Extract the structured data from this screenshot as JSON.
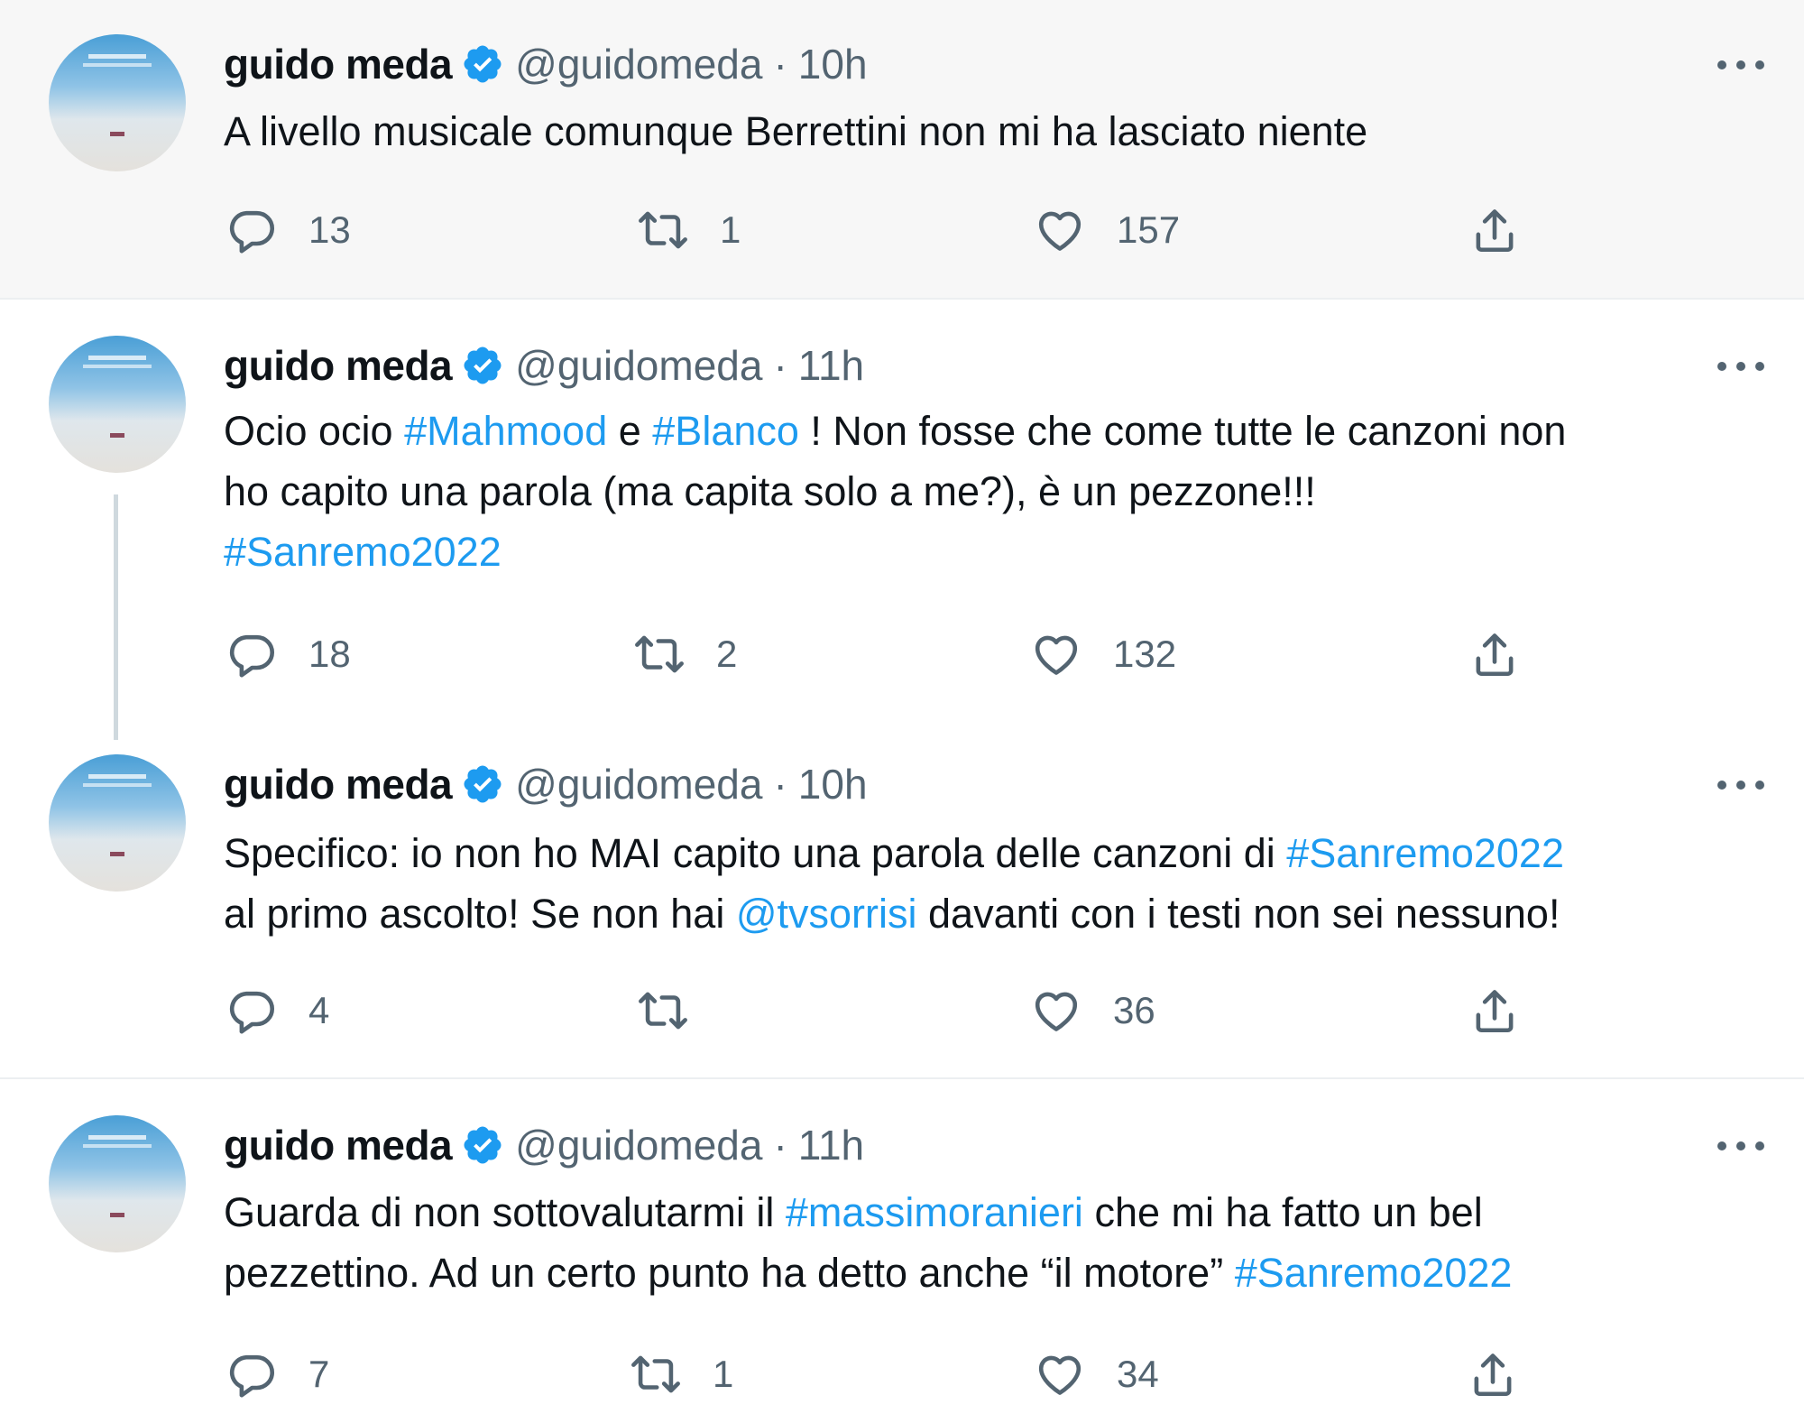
{
  "colors": {
    "link": "#1d9bf0",
    "muted": "#536471",
    "verified": "#1d9bf0"
  },
  "tweets": [
    {
      "name": "guido meda",
      "handle": "@guidomeda",
      "separator": "·",
      "time": "10h",
      "segments": [
        {
          "t": "A livello musicale comunque Berrettini non mi ha lasciato niente"
        }
      ],
      "replies": "13",
      "retweets": "1",
      "likes": "157"
    },
    {
      "name": "guido meda",
      "handle": "@guidomeda",
      "separator": "·",
      "time": "11h",
      "segments": [
        {
          "t": "Ocio ocio "
        },
        {
          "t": "#Mahmood",
          "link": true
        },
        {
          "t": " e "
        },
        {
          "t": "#Blanco",
          "link": true
        },
        {
          "t": " ! Non fosse che come tutte le canzoni non",
          "br": true
        },
        {
          "t": "ho capito una parola (ma capita solo a me?), è un pezzone!!!",
          "br": true
        },
        {
          "t": "#Sanremo2022",
          "link": true
        }
      ],
      "replies": "18",
      "retweets": "2",
      "likes": "132"
    },
    {
      "name": "guido meda",
      "handle": "@guidomeda",
      "separator": "·",
      "time": "10h",
      "segments": [
        {
          "t": "Specifico: io non ho MAI capito una parola delle canzoni di "
        },
        {
          "t": "#Sanremo2022",
          "link": true,
          "br": true
        },
        {
          "t": "al primo ascolto! Se non hai "
        },
        {
          "t": "@tvsorrisi",
          "link": true
        },
        {
          "t": " davanti con i testi non sei nessuno!"
        }
      ],
      "replies": "4",
      "retweets": "",
      "likes": "36"
    },
    {
      "name": "guido meda",
      "handle": "@guidomeda",
      "separator": "·",
      "time": "11h",
      "segments": [
        {
          "t": "Guarda di non sottovalutarmi il "
        },
        {
          "t": "#massimoranieri",
          "link": true
        },
        {
          "t": " che mi ha fatto un bel",
          "br": true
        },
        {
          "t": "pezzettino. Ad un certo punto ha detto anche “il motore” "
        },
        {
          "t": "#Sanremo2022",
          "link": true
        }
      ],
      "replies": "7",
      "retweets": "1",
      "likes": "34"
    }
  ]
}
